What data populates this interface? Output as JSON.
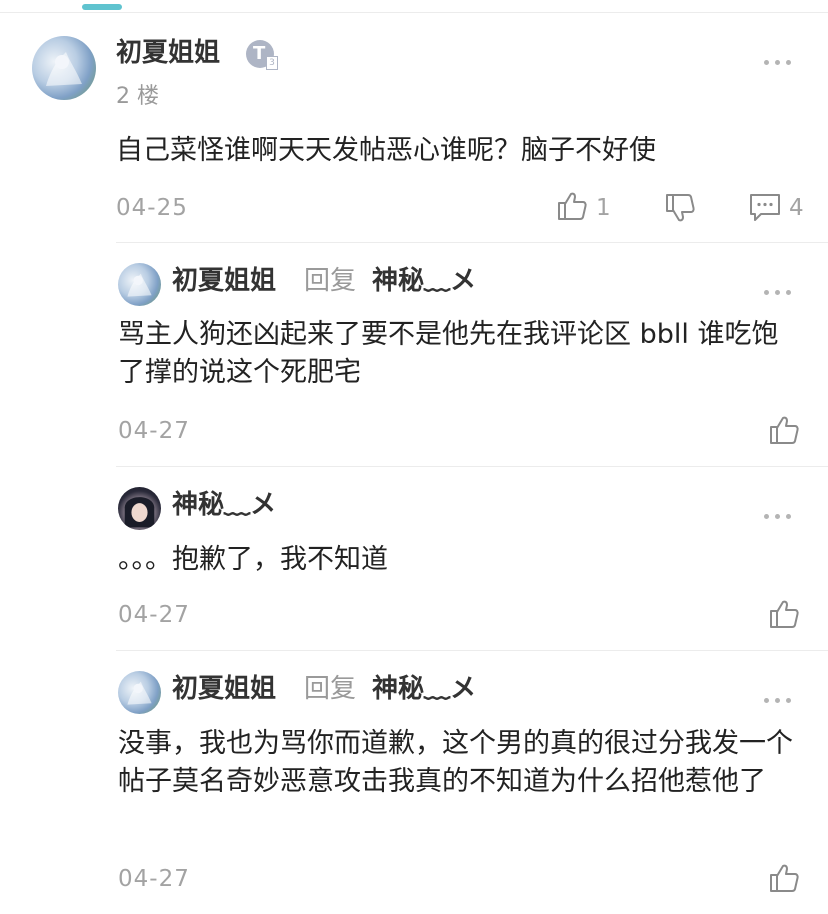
{
  "comment": {
    "author": "初夏姐姐",
    "level_badge": "T",
    "level_sub": "3",
    "floor": "2 楼",
    "text": "自己菜怪谁啊天天发帖恶心谁呢？脑子不好使",
    "date": "04-25",
    "like_count": "1",
    "reply_count": "4"
  },
  "replies": [
    {
      "author": "初夏姐姐",
      "reply_word": "回复",
      "target": "神秘﹏メ",
      "text": "骂主人狗还凶起来了要不是他先在我评论区 bbll 谁吃饱了撑的说这个死肥宅",
      "date": "04-27"
    },
    {
      "author": "神秘﹏メ",
      "text": "。。。抱歉了，我不知道",
      "date": "04-27"
    },
    {
      "author": "初夏姐姐",
      "reply_word": "回复",
      "target": "神秘﹏メ",
      "text": "没事，我也为骂你而道歉，这个男的真的很过分我发一个帖子莫名奇妙恶意攻击我真的不知道为什么招他惹他了",
      "date": "04-27"
    }
  ],
  "icons": {
    "more": "more-dots-icon",
    "like": "thumbs-up-icon",
    "dislike": "thumbs-down-icon",
    "comment": "comment-bubble-icon"
  },
  "colors": {
    "accent": "#5fc3cf",
    "text": "#222222",
    "muted": "#a3a3a3"
  }
}
